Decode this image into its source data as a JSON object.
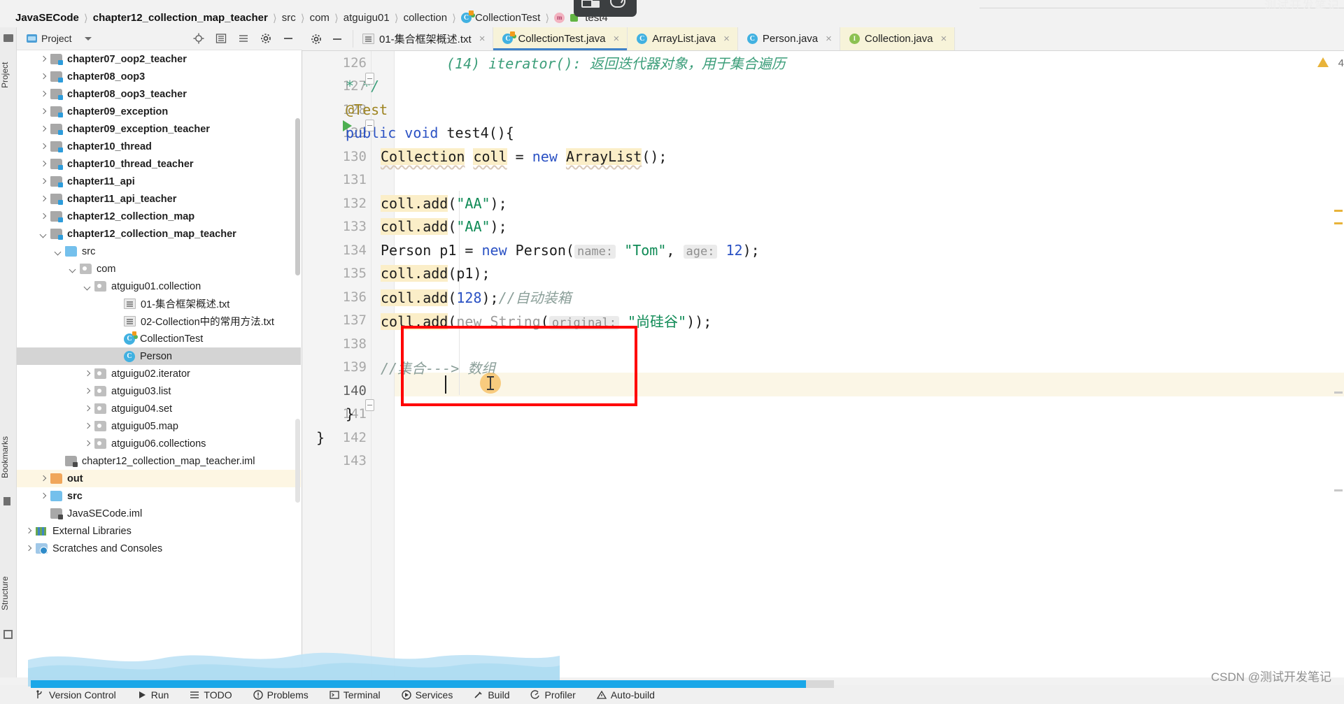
{
  "window": {
    "faint_top_right_text": "测试开发笔记"
  },
  "breadcrumb": {
    "items": [
      {
        "label": "JavaSECode",
        "icon": "none",
        "bold": true
      },
      {
        "label": "chapter12_collection_map_teacher",
        "icon": "none",
        "bold": true
      },
      {
        "label": "src",
        "icon": "none",
        "bold": false
      },
      {
        "label": "com",
        "icon": "none",
        "bold": false
      },
      {
        "label": "atguigu01",
        "icon": "none",
        "bold": false
      },
      {
        "label": "collection",
        "icon": "none",
        "bold": false
      },
      {
        "label": "CollectionTest",
        "icon": "test-class-icon",
        "bold": false
      },
      {
        "label": "test4",
        "icon": "method-icon",
        "bold": false
      }
    ]
  },
  "project_panel": {
    "title": "Project",
    "toolbar_icons": [
      "locate-icon",
      "collapse-all-icon",
      "expand-all-icon",
      "settings-gear-icon",
      "hide-icon"
    ],
    "tree": [
      {
        "label": "chapter07_oop2_teacher",
        "indent": 1,
        "arrow": "right",
        "icon": "module",
        "state": "normal"
      },
      {
        "label": "chapter08_oop3",
        "indent": 1,
        "arrow": "right",
        "icon": "module",
        "state": "normal"
      },
      {
        "label": "chapter08_oop3_teacher",
        "indent": 1,
        "arrow": "right",
        "icon": "module",
        "state": "normal"
      },
      {
        "label": "chapter09_exception",
        "indent": 1,
        "arrow": "right",
        "icon": "module",
        "state": "normal"
      },
      {
        "label": "chapter09_exception_teacher",
        "indent": 1,
        "arrow": "right",
        "icon": "module",
        "state": "normal"
      },
      {
        "label": "chapter10_thread",
        "indent": 1,
        "arrow": "right",
        "icon": "module",
        "state": "normal"
      },
      {
        "label": "chapter10_thread_teacher",
        "indent": 1,
        "arrow": "right",
        "icon": "module",
        "state": "normal"
      },
      {
        "label": "chapter11_api",
        "indent": 1,
        "arrow": "right",
        "icon": "module",
        "state": "normal"
      },
      {
        "label": "chapter11_api_teacher",
        "indent": 1,
        "arrow": "right",
        "icon": "module",
        "state": "normal"
      },
      {
        "label": "chapter12_collection_map",
        "indent": 1,
        "arrow": "right",
        "icon": "module",
        "state": "normal"
      },
      {
        "label": "chapter12_collection_map_teacher",
        "indent": 1,
        "arrow": "down",
        "icon": "module",
        "state": "normal"
      },
      {
        "label": "src",
        "indent": 2,
        "arrow": "down",
        "icon": "source-folder",
        "state": "normal"
      },
      {
        "label": "com",
        "indent": 3,
        "arrow": "down",
        "icon": "package",
        "state": "normal"
      },
      {
        "label": "atguigu01.collection",
        "indent": 4,
        "arrow": "down",
        "icon": "package",
        "state": "normal"
      },
      {
        "label": "01-集合框架概述.txt",
        "indent": 6,
        "arrow": "none",
        "icon": "text-file",
        "state": "normal"
      },
      {
        "label": "02-Collection中的常用方法.txt",
        "indent": 6,
        "arrow": "none",
        "icon": "text-file",
        "state": "normal"
      },
      {
        "label": "CollectionTest",
        "indent": 6,
        "arrow": "none",
        "icon": "test-class",
        "state": "normal"
      },
      {
        "label": "Person",
        "indent": 6,
        "arrow": "none",
        "icon": "class",
        "state": "selected"
      },
      {
        "label": "atguigu02.iterator",
        "indent": 4,
        "arrow": "right",
        "icon": "package",
        "state": "normal"
      },
      {
        "label": "atguigu03.list",
        "indent": 4,
        "arrow": "right",
        "icon": "package",
        "state": "normal"
      },
      {
        "label": "atguigu04.set",
        "indent": 4,
        "arrow": "right",
        "icon": "package",
        "state": "normal"
      },
      {
        "label": "atguigu05.map",
        "indent": 4,
        "arrow": "right",
        "icon": "package",
        "state": "normal"
      },
      {
        "label": "atguigu06.collections",
        "indent": 4,
        "arrow": "right",
        "icon": "package",
        "state": "normal"
      },
      {
        "label": "chapter12_collection_map_teacher.iml",
        "indent": 2,
        "arrow": "none",
        "icon": "module-file",
        "state": "normal"
      },
      {
        "label": "out",
        "indent": 1,
        "arrow": "right",
        "icon": "out-folder",
        "state": "highlighted"
      },
      {
        "label": "src",
        "indent": 1,
        "arrow": "right",
        "icon": "source-folder",
        "state": "normal"
      },
      {
        "label": "JavaSECode.iml",
        "indent": 1,
        "arrow": "none",
        "icon": "module-file",
        "state": "normal"
      },
      {
        "label": "External Libraries",
        "indent": 0,
        "arrow": "right",
        "icon": "libraries",
        "state": "normal"
      },
      {
        "label": "Scratches and Consoles",
        "indent": 0,
        "arrow": "right",
        "icon": "scratches",
        "state": "normal"
      }
    ]
  },
  "left_tool_strips": [
    {
      "label": "Project"
    },
    {
      "label": "Bookmarks"
    },
    {
      "label": "Structure"
    }
  ],
  "editor_tabs": [
    {
      "label": "01-集合框架概述.txt",
      "icon": "text-file-icon",
      "active": false
    },
    {
      "label": "CollectionTest.java",
      "icon": "test-class-icon",
      "active": true
    },
    {
      "label": "ArrayList.java",
      "icon": "class-icon",
      "active": false
    },
    {
      "label": "Person.java",
      "icon": "class-icon",
      "active": false
    },
    {
      "label": "Collection.java",
      "icon": "interface-icon",
      "active": false
    }
  ],
  "editor": {
    "inspection_warning_count": "4",
    "lines": [
      {
        "num": "126",
        "text": "(14) iterator(): 返回迭代器对象，用于集合遍历",
        "type": "javadoc-cn"
      },
      {
        "num": "127",
        "text": "* */",
        "type": "comment-end"
      },
      {
        "num": "128",
        "text": "@Test",
        "type": "annotation"
      },
      {
        "num": "129",
        "text": "public void test4(){",
        "type": "method-decl"
      },
      {
        "num": "130",
        "text": "Collection coll = new ArrayList();",
        "type": "code"
      },
      {
        "num": "131",
        "text": "",
        "type": "blank"
      },
      {
        "num": "132",
        "text": "coll.add(\"AA\");",
        "type": "code"
      },
      {
        "num": "133",
        "text": "coll.add(\"AA\");",
        "type": "code"
      },
      {
        "num": "134",
        "text": "Person p1 = new Person( name: \"Tom\", age: 12);",
        "type": "code"
      },
      {
        "num": "135",
        "text": "coll.add(p1);",
        "type": "code"
      },
      {
        "num": "136",
        "text": "coll.add(128);//自动装箱",
        "type": "code"
      },
      {
        "num": "137",
        "text": "coll.add(new String( original: \"尚硅谷\"));",
        "type": "code"
      },
      {
        "num": "138",
        "text": "",
        "type": "blank"
      },
      {
        "num": "139",
        "text": "//集合---> 数组",
        "type": "comment"
      },
      {
        "num": "140",
        "text": "",
        "type": "caret-line"
      },
      {
        "num": "141",
        "text": "}",
        "type": "close"
      },
      {
        "num": "142",
        "text": "}",
        "type": "close"
      },
      {
        "num": "143",
        "text": "",
        "type": "blank"
      }
    ],
    "inlay_hints": [
      {
        "line": "134",
        "label": "name:"
      },
      {
        "line": "134",
        "label": "age:"
      },
      {
        "line": "137",
        "label": "original:"
      }
    ],
    "annotation_box": {
      "label": "red-highlight-box",
      "color": "#ff0000"
    }
  },
  "status_bar": {
    "items": [
      {
        "label": "Version Control",
        "icon": "branch-icon"
      },
      {
        "label": "Run",
        "icon": "run-icon"
      },
      {
        "label": "TODO",
        "icon": "todo-icon"
      },
      {
        "label": "Problems",
        "icon": "problems-icon"
      },
      {
        "label": "Terminal",
        "icon": "terminal-icon"
      },
      {
        "label": "Services",
        "icon": "services-icon"
      },
      {
        "label": "Build",
        "icon": "build-icon"
      },
      {
        "label": "Profiler",
        "icon": "profiler-icon"
      },
      {
        "label": "Auto-build",
        "icon": "warning-icon"
      }
    ]
  },
  "watermark": "CSDN @测试开发笔记"
}
